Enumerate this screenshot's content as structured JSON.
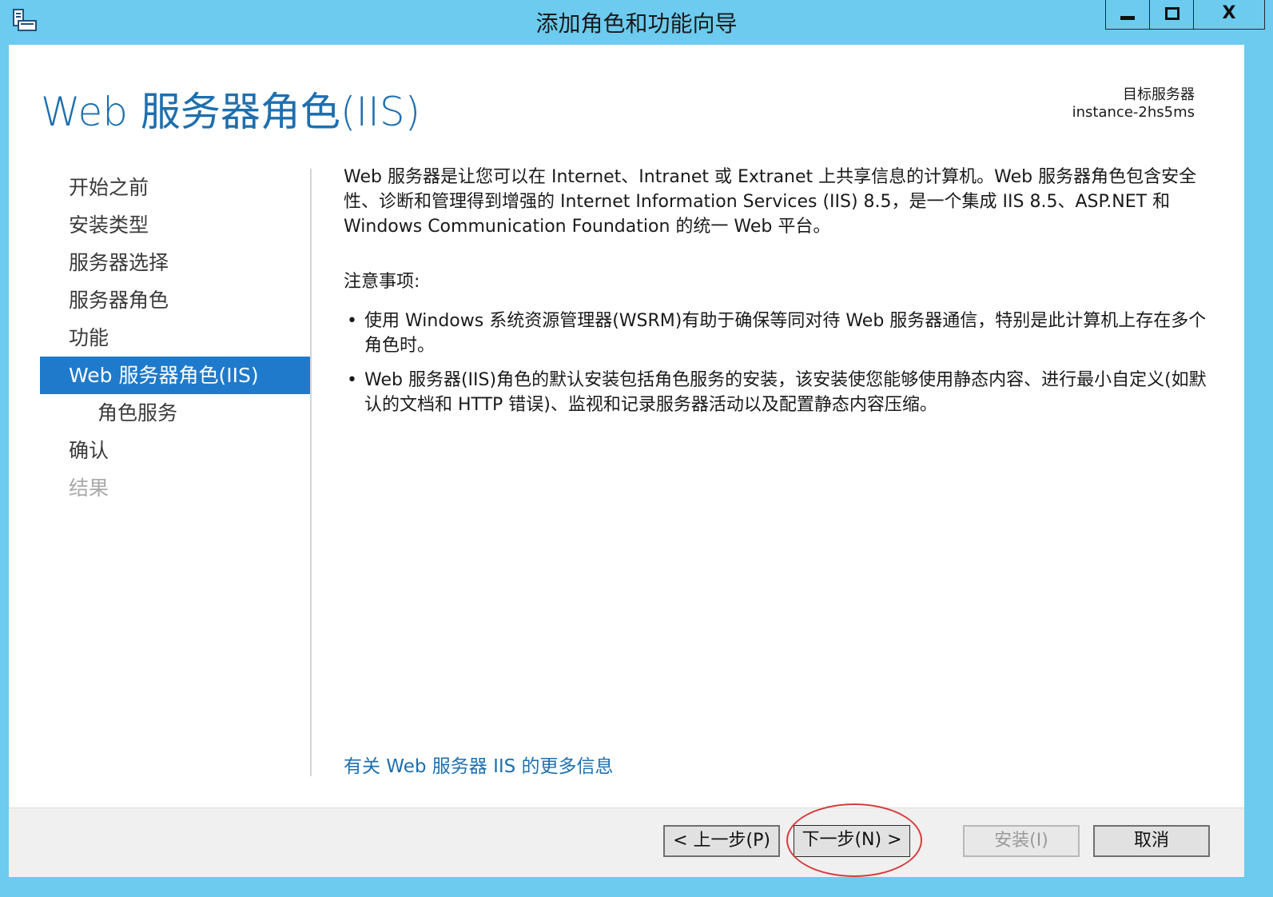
{
  "window": {
    "title": "添加角色和功能向导",
    "close_glyph": "X"
  },
  "header": {
    "title": "Web 服务器角色(IIS)",
    "target_label": "目标服务器",
    "target_name": "instance-2hs5ms"
  },
  "nav": {
    "items": [
      {
        "label": "开始之前",
        "state": "normal"
      },
      {
        "label": "安装类型",
        "state": "normal"
      },
      {
        "label": "服务器选择",
        "state": "normal"
      },
      {
        "label": "服务器角色",
        "state": "normal"
      },
      {
        "label": "功能",
        "state": "normal"
      },
      {
        "label": "Web 服务器角色(IIS)",
        "state": "active"
      },
      {
        "label": "角色服务",
        "state": "sub"
      },
      {
        "label": "确认",
        "state": "normal"
      },
      {
        "label": "结果",
        "state": "disabled"
      }
    ]
  },
  "content": {
    "description": "Web 服务器是让您可以在 Internet、Intranet 或 Extranet 上共享信息的计算机。Web 服务器角色包含安全性、诊断和管理得到增强的 Internet Information Services (IIS) 8.5，是一个集成 IIS 8.5、ASP.NET 和 Windows Communication Foundation 的统一 Web 平台。",
    "notes_title": "注意事项:",
    "bullet_glyph": "•",
    "bullets": [
      "使用 Windows 系统资源管理器(WSRM)有助于确保等同对待 Web 服务器通信，特别是此计算机上存在多个角色时。",
      "Web 服务器(IIS)角色的默认安装包括角色服务的安装，该安装使您能够使用静态内容、进行最小自定义(如默认的文档和 HTTP 错误)、监视和记录服务器活动以及配置静态内容压缩。"
    ],
    "more_info_link": "有关 Web 服务器 IIS 的更多信息"
  },
  "footer": {
    "prev_label": "< 上一步(P)",
    "next_label": "下一步(N) >",
    "install_label": "安装(I)",
    "cancel_label": "取消"
  },
  "colors": {
    "titlebar": "#6ccbef",
    "accent": "#1f7acb",
    "heading": "#1e6fae",
    "annotation": "#d83a3a"
  }
}
